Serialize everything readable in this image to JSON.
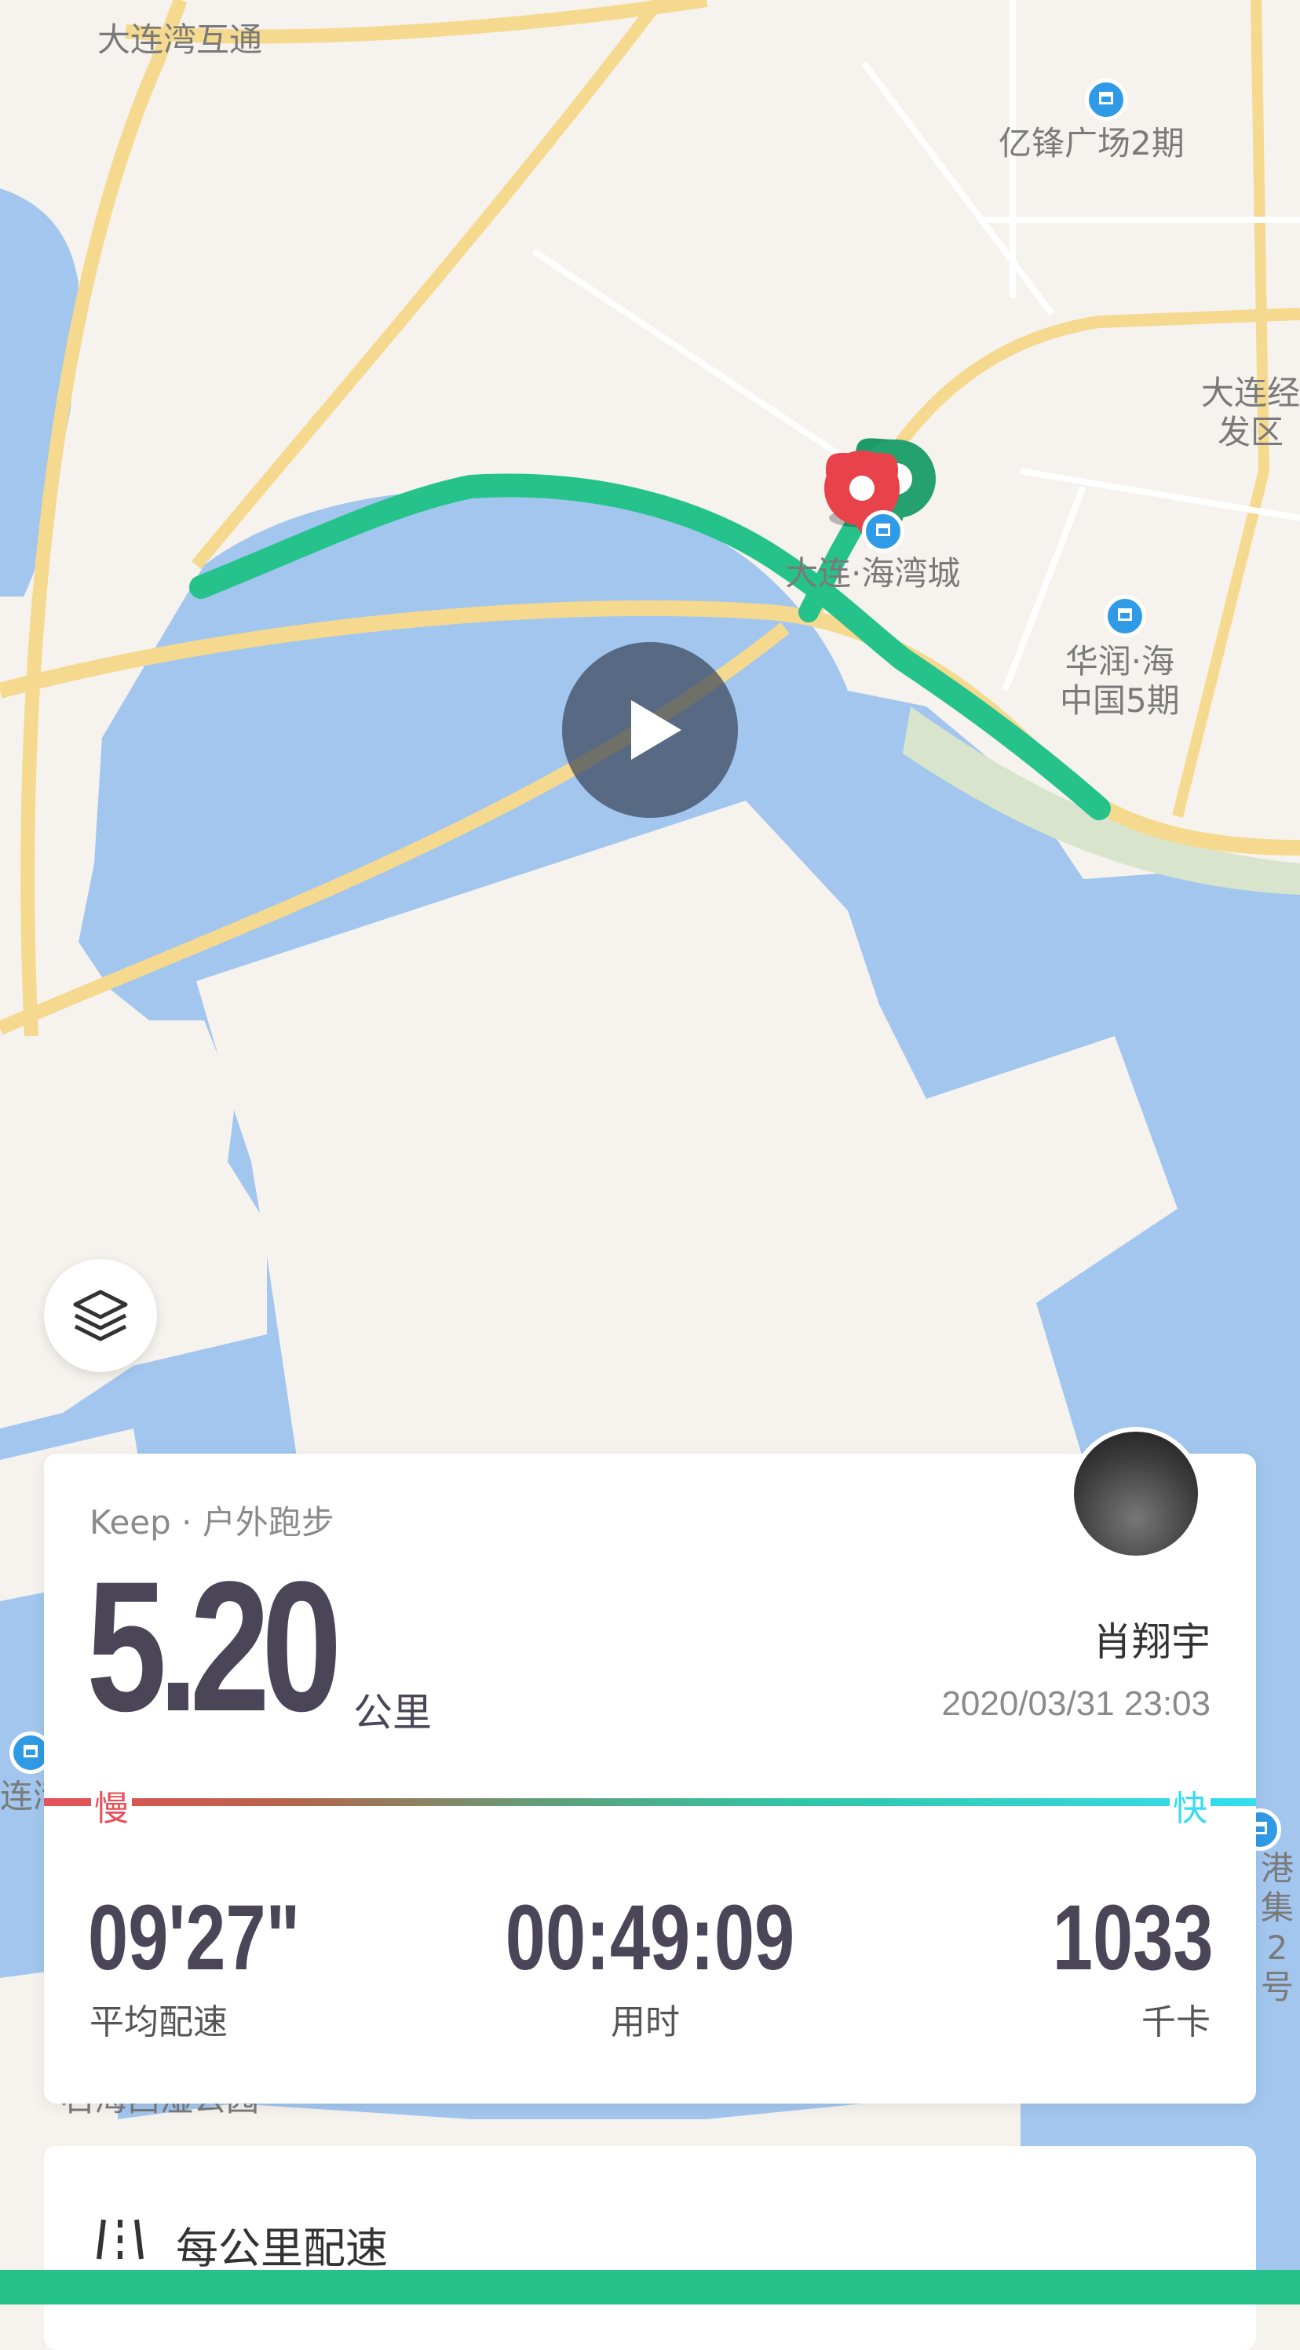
{
  "map": {
    "labels": {
      "interchange": "大连湾互通",
      "plaza": "亿锋广场2期",
      "dev_zone": "大连经\n发区",
      "bay_city": "大连·海湾城",
      "china_res": "华润·海\n中国5期",
      "left_edge": "连湾",
      "right_edge": "港集\n2号",
      "park": "石海西湿公园"
    },
    "route_color": "#25c38b",
    "water_color": "#a2c6ee"
  },
  "controls": {
    "play_icon": "play-icon",
    "layers_icon": "layers-icon"
  },
  "summary": {
    "app_line": "Keep · 户外跑步",
    "distance": "5.20",
    "distance_unit": "公里",
    "user_name": "肖翔宇",
    "date": "2020/03/31 23:03",
    "pace_slow": "慢",
    "pace_fast": "快",
    "avg_pace_value": "09'27\"",
    "avg_pace_label": "平均配速",
    "duration_value": "00:49:09",
    "duration_label": "用时",
    "calories_value": "1033",
    "calories_label": "千卡"
  },
  "section": {
    "per_km_title": "每公里配速"
  },
  "colors": {
    "slow": "#e8505a",
    "fast": "#35ddee",
    "accent": "#25c38b"
  }
}
